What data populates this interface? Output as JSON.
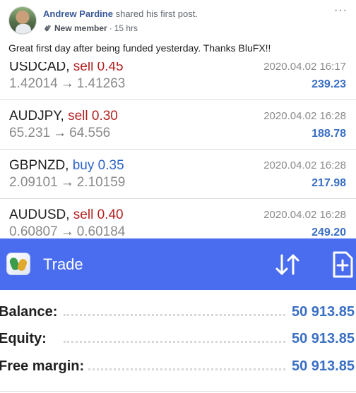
{
  "post": {
    "author": "Andrew Pardine",
    "action": "shared his first post.",
    "badge": "New member",
    "separator": "·",
    "time": "15 hrs",
    "more": "···",
    "text": "Great first day after being funded yesterday. Thanks BluFX!!"
  },
  "trades": [
    {
      "symbol": "USDCAD,",
      "direction": "sell",
      "volume": "0.45",
      "open": "1.42014",
      "arrow": "→",
      "close": "1.41263",
      "datetime": "2020.04.02 16:17",
      "profit": "239.23"
    },
    {
      "symbol": "AUDJPY,",
      "direction": "sell",
      "volume": "0.30",
      "open": "65.231",
      "arrow": "→",
      "close": "64.556",
      "datetime": "2020.04.02 16:28",
      "profit": "188.78"
    },
    {
      "symbol": "GBPNZD,",
      "direction": "buy",
      "volume": "0.35",
      "open": "2.09101",
      "arrow": "→",
      "close": "2.10159",
      "datetime": "2020.04.02 16:28",
      "profit": "217.98"
    },
    {
      "symbol": "AUDUSD,",
      "direction": "sell",
      "volume": "0.40",
      "open": "0.60807",
      "arrow": "→",
      "close": "0.60184",
      "datetime": "2020.04.02 16:28",
      "profit": "249.20"
    }
  ],
  "trade_bar": {
    "title": "Trade",
    "bar_color": "#4a6df0"
  },
  "summary": [
    {
      "label": "Balance:",
      "value": "50 913.85"
    },
    {
      "label": "Equity:",
      "value": "50 913.85"
    },
    {
      "label": "Free margin:",
      "value": "50 913.85"
    }
  ],
  "colors": {
    "sell": "#b22222",
    "buy": "#2d63c8",
    "profit": "#3a6fc4",
    "author": "#385898"
  },
  "icons": {
    "avatar": "profile-photo",
    "badge": "wave-hand-icon",
    "more": "more-options-icon",
    "logo": "metatrader-logo-icon",
    "sort": "sort-arrows-icon",
    "new_order": "new-order-document-icon"
  }
}
